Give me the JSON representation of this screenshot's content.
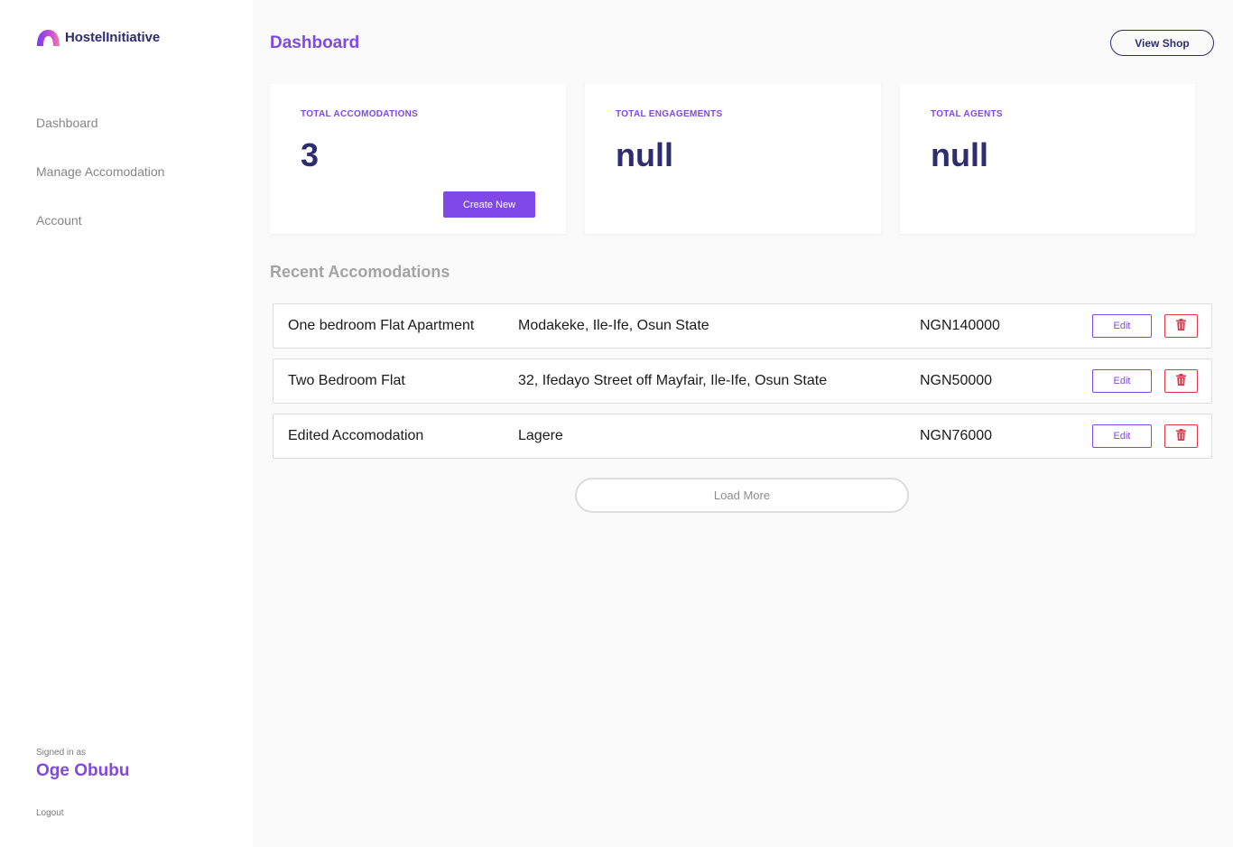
{
  "app": {
    "logo_text": "HostelInitiative",
    "brand_colors": {
      "primary": "#8148e8",
      "navy": "#2e2d6e",
      "danger": "#e0384a"
    }
  },
  "sidebar": {
    "items": [
      {
        "label": "Dashboard"
      },
      {
        "label": "Manage Accomodation"
      },
      {
        "label": "Account"
      }
    ],
    "signed_in_label": "Signed in as",
    "user_name": "Oge Obubu",
    "logout_label": "Logout"
  },
  "header": {
    "title": "Dashboard",
    "view_shop_label": "View Shop"
  },
  "stats": [
    {
      "label": "TOTAL ACCOMODATIONS",
      "value": "3",
      "action_label": "Create New"
    },
    {
      "label": "TOTAL ENGAGEMENTS",
      "value": "null"
    },
    {
      "label": "TOTAL AGENTS",
      "value": "null"
    }
  ],
  "recent": {
    "title": "Recent Accomodations",
    "rows": [
      {
        "name": "One bedroom Flat Apartment",
        "location": "Modakeke, Ile-Ife, Osun State",
        "price": "NGN140000",
        "edit_label": "Edit",
        "delete_icon": "trash-icon"
      },
      {
        "name": "Two Bedroom Flat",
        "location": "32, Ifedayo Street off Mayfair, Ile-Ife, Osun State",
        "price": "NGN50000",
        "edit_label": "Edit",
        "delete_icon": "trash-icon"
      },
      {
        "name": "Edited Accomodation",
        "location": "Lagere",
        "price": "NGN76000",
        "edit_label": "Edit",
        "delete_icon": "trash-icon"
      }
    ],
    "load_more_label": "Load More"
  }
}
